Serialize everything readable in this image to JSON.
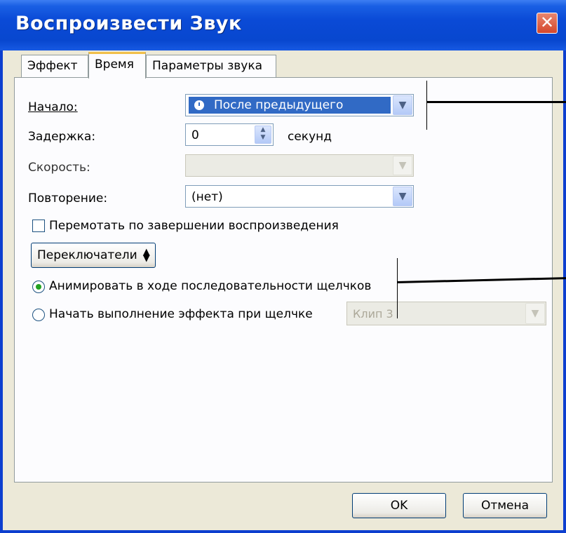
{
  "window": {
    "title": "Воспроизвести Звук",
    "close_glyph": "✕"
  },
  "tabs": [
    {
      "label": "Эффект"
    },
    {
      "label": "Время",
      "selected": true
    },
    {
      "label": "Параметры звука"
    }
  ],
  "timing": {
    "start_label": "Начало:",
    "start_value": "После предыдущего",
    "delay_label": "Задержка:",
    "delay_value": "0",
    "delay_unit": "секунд",
    "speed_label": "Скорость:",
    "speed_value": "",
    "repeat_label": "Повторение:",
    "repeat_value": "(нет)",
    "rewind_label": "Перемотать по завершении воспроизведения",
    "rewind_checked": false
  },
  "triggers": {
    "button_label": "Переключатели",
    "button_icon": "up-down-arrows-icon",
    "option_animate": "Анимировать в ходе последовательности щелчков",
    "option_start_on_click": "Начать выполнение эффекта при щелчке",
    "selected_option": "animate",
    "clip_value": "Клип 3"
  },
  "buttons": {
    "ok": "OK",
    "cancel": "Отмена"
  },
  "colors": {
    "titlebar": "#0a4ad6",
    "selection": "#316ac5",
    "dialog": "#ece9d8"
  }
}
